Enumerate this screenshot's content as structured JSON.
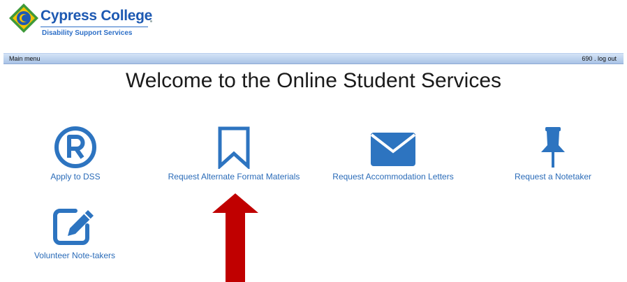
{
  "header": {
    "college_name": "Cypress College",
    "department": "Disability Support Services"
  },
  "menubar": {
    "main_menu": "Main menu",
    "user_id": "690",
    "separator": " . ",
    "logout": "log out"
  },
  "page": {
    "title": "Welcome to the Online Student Services"
  },
  "services": {
    "apply_dss": "Apply to DSS",
    "alternate_format": "Request Alternate Format Materials",
    "accommodation_letters": "Request Accommodation Letters",
    "notetaker": "Request a Notetaker",
    "volunteer": "Volunteer Note-takers"
  },
  "icons": {
    "apply_dss": "registered-icon",
    "alternate_format": "bookmark-icon",
    "accommodation_letters": "envelope-icon",
    "notetaker": "pushpin-icon",
    "volunteer": "edit-icon",
    "annotation": "arrow-up-icon"
  },
  "colors": {
    "icon_blue": "#2d74c0",
    "link_blue": "#2a6bb8",
    "brand_blue": "#1d59b2",
    "logo_yellow": "#f3c200",
    "logo_green": "#3f9a3a",
    "arrow_red": "#c00000"
  }
}
